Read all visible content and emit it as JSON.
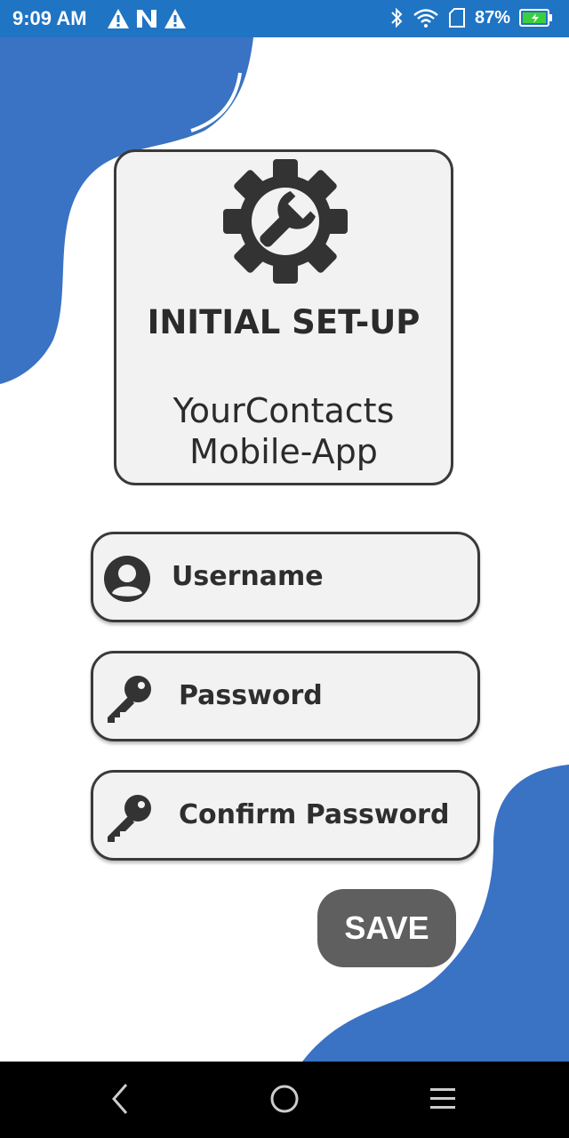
{
  "status_bar": {
    "time": "9:09 AM",
    "battery_percent": "87%",
    "left_icons": [
      "warning-icon",
      "n-logo-icon",
      "warning-icon"
    ],
    "right_icons": [
      "bluetooth-icon",
      "wifi-icon",
      "sim-icon",
      "battery-icon"
    ]
  },
  "header": {
    "icon": "gear-wrench-icon",
    "title": "INITIAL SET-UP",
    "subtitle_line1": "YourContacts",
    "subtitle_line2": "Mobile-App"
  },
  "form": {
    "username_placeholder": "Username",
    "password_placeholder": "Password",
    "confirm_password_placeholder": "Confirm Password"
  },
  "save_label": "SAVE",
  "colors": {
    "accent_blue": "#3a72c4",
    "status_bar": "#1f74c4",
    "card_bg": "#f2f2f2",
    "button_bg": "#5f5f5f"
  },
  "nav": [
    "back-icon",
    "home-icon",
    "menu-icon"
  ]
}
